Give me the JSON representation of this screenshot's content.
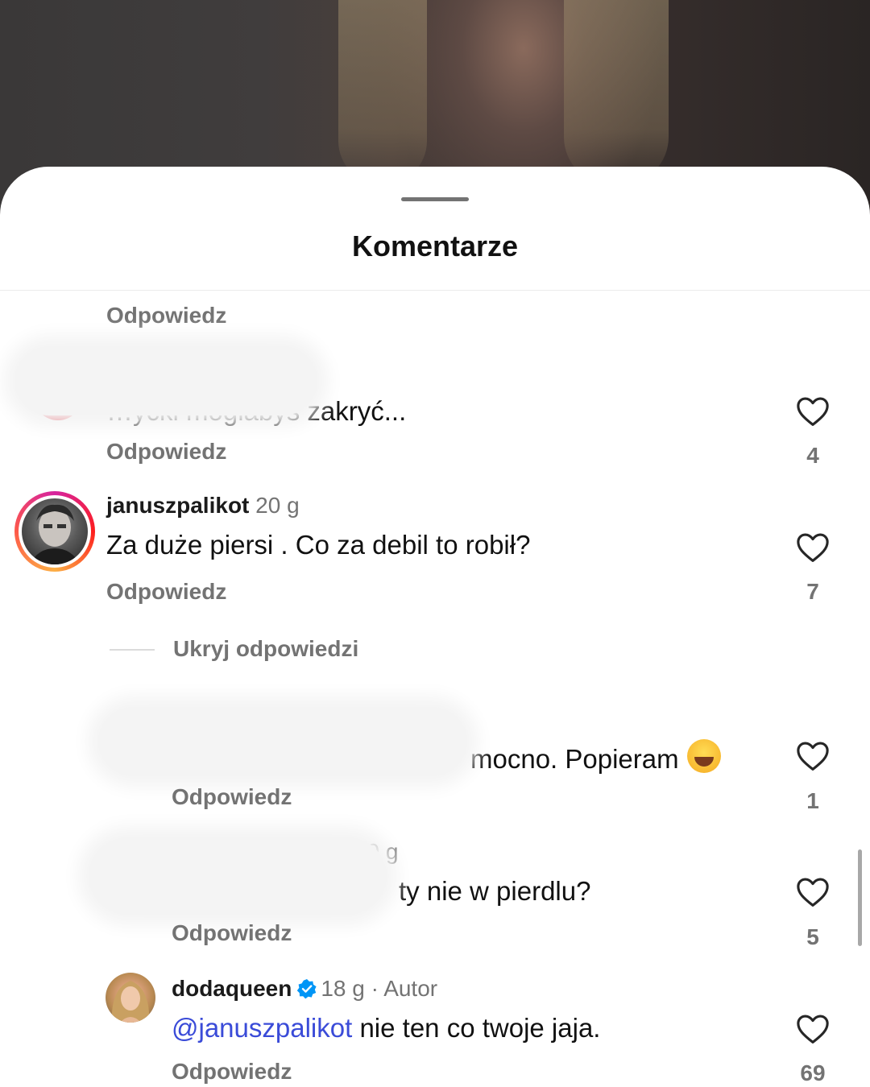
{
  "sheet": {
    "title": "Komentarze"
  },
  "comments": [
    {
      "reply_label": "Odpowiedz"
    },
    {
      "text": "…ycki mogłabyś zakryć...",
      "reply_label": "Odpowiedz",
      "likes": "4"
    },
    {
      "username": "januszpalikot",
      "time": "20 g",
      "text": "Za duże piersi . Co za debil to robił?",
      "reply_label": "Odpowiedz",
      "likes": "7"
    }
  ],
  "thread": {
    "hide_label": "Ukryj odpowiedzi"
  },
  "replies": [
    {
      "text": "mocno. Popieram",
      "reply_label": "Odpowiedz",
      "likes": "1"
    },
    {
      "time": "19 g",
      "text": "ty nie w pierdlu?",
      "reply_label": "Odpowiedz",
      "likes": "5"
    },
    {
      "username": "dodaqueen",
      "time": "18 g",
      "author_badge": "Autor",
      "mention": "@januszpalikot",
      "text": " nie ten co twoje jaja.",
      "reply_label": "Odpowiedz",
      "likes": "69"
    }
  ],
  "colors": {
    "verified_blue": "#0095f6",
    "mention_blue": "#3a4bd8",
    "muted_gray": "#737373"
  },
  "icons": [
    "heart-icon",
    "verified-badge-icon",
    "laughing-emoji-icon"
  ]
}
